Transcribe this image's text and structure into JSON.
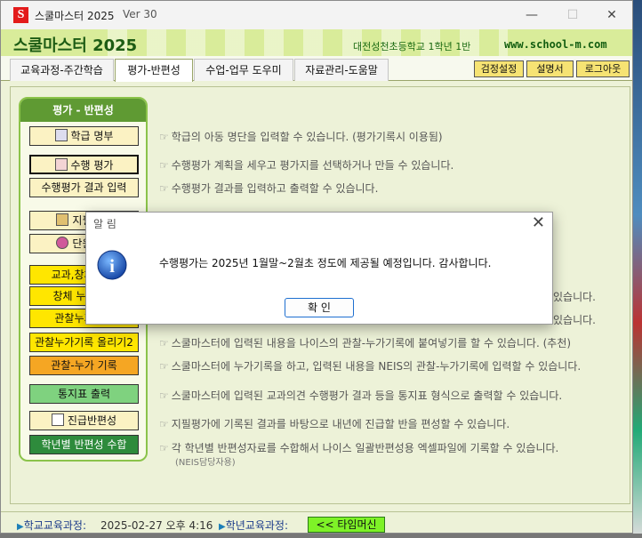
{
  "window": {
    "icon_letter": "S",
    "title": "스쿨마스터 2025",
    "version": "Ver 30",
    "minimize": "—",
    "maximize": "☐",
    "close": "✕"
  },
  "header": {
    "brand": "스쿨마스터 2025",
    "school": "대전성천초등학교 1학년 1반",
    "site": "www.school-m.com"
  },
  "tabs": [
    {
      "label": "교육과정-주간학습"
    },
    {
      "label": "평가-반편성"
    },
    {
      "label": "수업-업무 도우미"
    },
    {
      "label": "자료관리-도움말"
    }
  ],
  "top_buttons": {
    "verify": "검정설정",
    "manual": "설명서",
    "logout": "로그아웃"
  },
  "panel": {
    "title": "평가 - 반편성",
    "buttons": [
      "학급 명부",
      "수행 평가",
      "수행평가 결과 입력",
      "지필평가",
      "단원평가",
      "교과,창체,행발",
      "창체 누가기록",
      "관찰누가기록",
      "관찰누가기록 올리기2",
      "관찰-누가 기록",
      "통지표 출력",
      "진급반편성",
      "학년별 반편성 수합"
    ]
  },
  "descriptions": [
    "학급의 아동 명단을 입력할 수 있습니다. (평가기록시 이용됨)",
    "수행평가 계획을 세우고 평가지를 선택하거나 만들 수 있습니다.",
    "수행평가 결과를 입력하고 출력할 수 있습니다.",
    "있습니다.",
    "있습니다.",
    "스쿨마스터에 입력된 내용을 나이스의 관찰-누가기록에 붙여넣기를 할 수 있습니다. (추천)",
    "스쿨마스터에 누가기록을 하고, 입력된 내용을 NEIS의 관찰-누가기록에 입력할 수 있습니다.",
    "스쿨마스터에 입력된 교과의견 수행평가 결과 등을 통지표 형식으로 출력할 수 있습니다.",
    "지필평가에 기록된 결과를 바탕으로 내년에 진급할 반을 편성할 수 있습니다.",
    "각 학년별 반편성자료를 수합해서 나이스 일괄반편성용 엑셀파일에 기록할 수 있습니다."
  ],
  "note": "(NEIS담당자용)",
  "status": {
    "school_label": "학교교육과정:",
    "school_value": "2025-02-27 오후 4:16",
    "grade_label": "학년교육과정:",
    "time_machine": "<< 타임머신"
  },
  "dialog": {
    "title": "알 림",
    "close": "✕",
    "icon_letter": "i",
    "message": "수행평가는 2025년 1월말~2월초 정도에 제공될 예정입니다. 감사합니다.",
    "ok": "확 인"
  },
  "colors": {
    "accent_green": "#5f9a33",
    "header_green": "#d9ec9a",
    "button_yellow": "#ffe600",
    "button_orange": "#f5a623",
    "dialog_accent": "#1e6fd0"
  }
}
